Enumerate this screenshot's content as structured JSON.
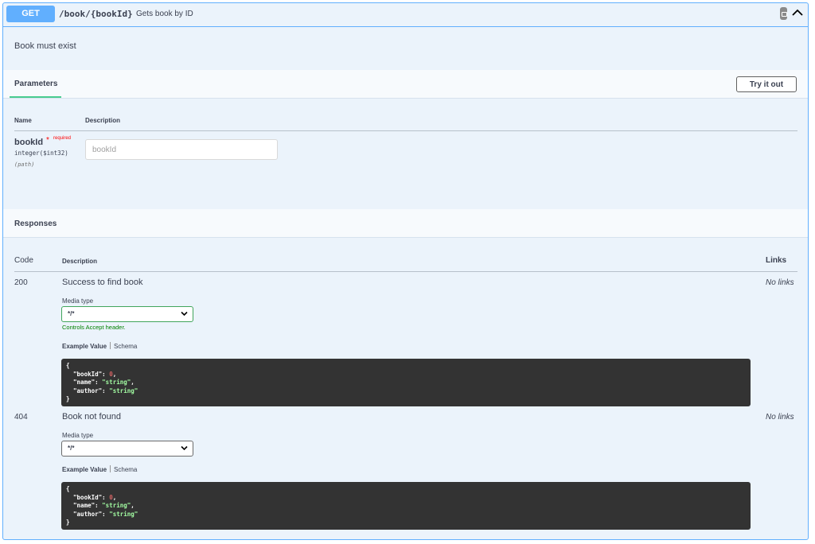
{
  "operation": {
    "method": "GET",
    "path": "/book/{bookId}",
    "summary": "Gets book by ID",
    "description": "Book must exist"
  },
  "parameters": {
    "tab_label": "Parameters",
    "try_button": "Try it out",
    "col_name": "Name",
    "col_description": "Description",
    "items": [
      {
        "name": "bookId",
        "required_star": "*",
        "required_label": "required",
        "type": "integer($int32)",
        "location": "(path)",
        "placeholder": "bookId"
      }
    ]
  },
  "responses": {
    "title": "Responses",
    "col_code": "Code",
    "col_description": "Description",
    "col_links": "Links",
    "items": [
      {
        "code": "200",
        "description": "Success to find book",
        "links": "No links",
        "media_type_label": "Media type",
        "media_type": "*/*",
        "accept_note": "Controls Accept header.",
        "example_tab": "Example Value",
        "schema_tab": "Schema"
      },
      {
        "code": "404",
        "description": "Book not found",
        "links": "No links",
        "media_type_label": "Media type",
        "media_type": "*/*",
        "example_tab": "Example Value",
        "schema_tab": "Schema"
      }
    ],
    "example": {
      "open": "{",
      "close": "}",
      "fields": [
        {
          "key": "\"bookId\"",
          "value": "0",
          "kind": "num",
          "trail": ","
        },
        {
          "key": "\"name\"",
          "value": "\"string\"",
          "kind": "str",
          "trail": ","
        },
        {
          "key": "\"author\"",
          "value": "\"string\"",
          "kind": "str",
          "trail": ""
        }
      ]
    }
  },
  "colors": {
    "get_accent": "#61affe",
    "panel_bg": "#ebf3fb",
    "success_green": "#49cc90",
    "required_red": "#ff0000",
    "code_bg": "#333333"
  },
  "icons": [
    "lock-icon",
    "chevron-up-icon",
    "chevron-down-icon"
  ]
}
